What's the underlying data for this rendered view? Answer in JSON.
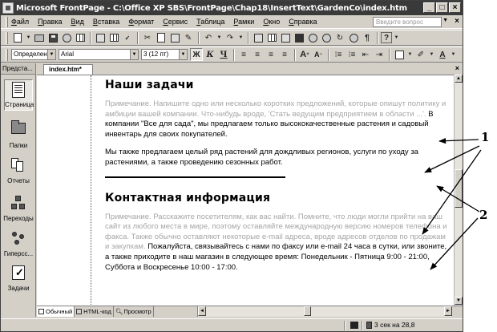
{
  "window": {
    "title": "Microsoft FrontPage - C:\\Office XP SBS\\FrontPage\\Chap18\\InsertText\\GardenCo\\index.htm",
    "minimize": "_",
    "maximize": "□",
    "close": "×"
  },
  "menu": {
    "items": [
      {
        "label": "Файл",
        "key": "Ф",
        "rest": "айл"
      },
      {
        "label": "Правка",
        "key": "П",
        "rest": "равка"
      },
      {
        "label": "Вид",
        "key": "В",
        "rest": "ид"
      },
      {
        "label": "Вставка",
        "key": "В",
        "rest": "ставка"
      },
      {
        "label": "Формат",
        "key": "Ф",
        "rest": "ормат"
      },
      {
        "label": "Сервис",
        "key": "С",
        "rest": "ервис"
      },
      {
        "label": "Таблица",
        "key": "Т",
        "rest": "аблица"
      },
      {
        "label": "Рамки",
        "key": "Р",
        "rest": "амки"
      },
      {
        "label": "Окно",
        "key": "О",
        "rest": "кно"
      },
      {
        "label": "Справка",
        "key": "С",
        "rest": "правка"
      }
    ],
    "question_placeholder": "Введите вопрос",
    "close": "×"
  },
  "format_bar": {
    "style": "Определен",
    "font": "Arial",
    "size": "3 (12 пт)",
    "bold": "Ж",
    "italic": "К",
    "underline": "Ч"
  },
  "views": {
    "header": "Предста...",
    "items": [
      {
        "label": "Страница"
      },
      {
        "label": "Папки"
      },
      {
        "label": "Отчеты"
      },
      {
        "label": "Переходы"
      },
      {
        "label": "Гиперсс..."
      },
      {
        "label": "Задачи"
      }
    ]
  },
  "document": {
    "tab": "index.htm*",
    "close": "×",
    "heading1": "Наши задачи",
    "para1_gray": "Примечание. Напишите одно или несколько коротких предложений, которые опишут политику и амбиции вашей компании. Что-нибудь вроде, 'Стать ведущим предприятием в области ...'.",
    "para1_text": " В компании \"Все для сада\", мы предлагаем только высококачественные растения и садовый инвентарь для своих покупателей.",
    "para2": "Мы также предлагаем целый ряд растений для дождливых регионов, услуги по уходу за растениями, а также проведению сезонных работ.",
    "heading2": "Контактная информация",
    "para3_gray": "Примечание. Расскажите посетителям, как вас найти. Помните, что люди могли прийти на ваш сайт из любого места в мире, поэтому оставляйте международную версию номеров телефона и факса. Также обычно оставляют некоторые e-mail адреса, вроде адресов отделов по продажам и закупкам.",
    "para3_text": " Пожалуйста, связывайтесь с нами по факсу или e-mail 24 часа в сутки, или звоните, а также приходите в наш магазин в следующее время: Понедельник - Пятница 9:00 - 21:00, Суббота и Воскресенье 10:00 - 17:00."
  },
  "modes": {
    "normal": "Обычный",
    "html": "HTML-код",
    "preview": "Просмотр"
  },
  "status": {
    "time": "3 сек на 28,8"
  },
  "callouts": {
    "one": "1",
    "two": "2"
  }
}
